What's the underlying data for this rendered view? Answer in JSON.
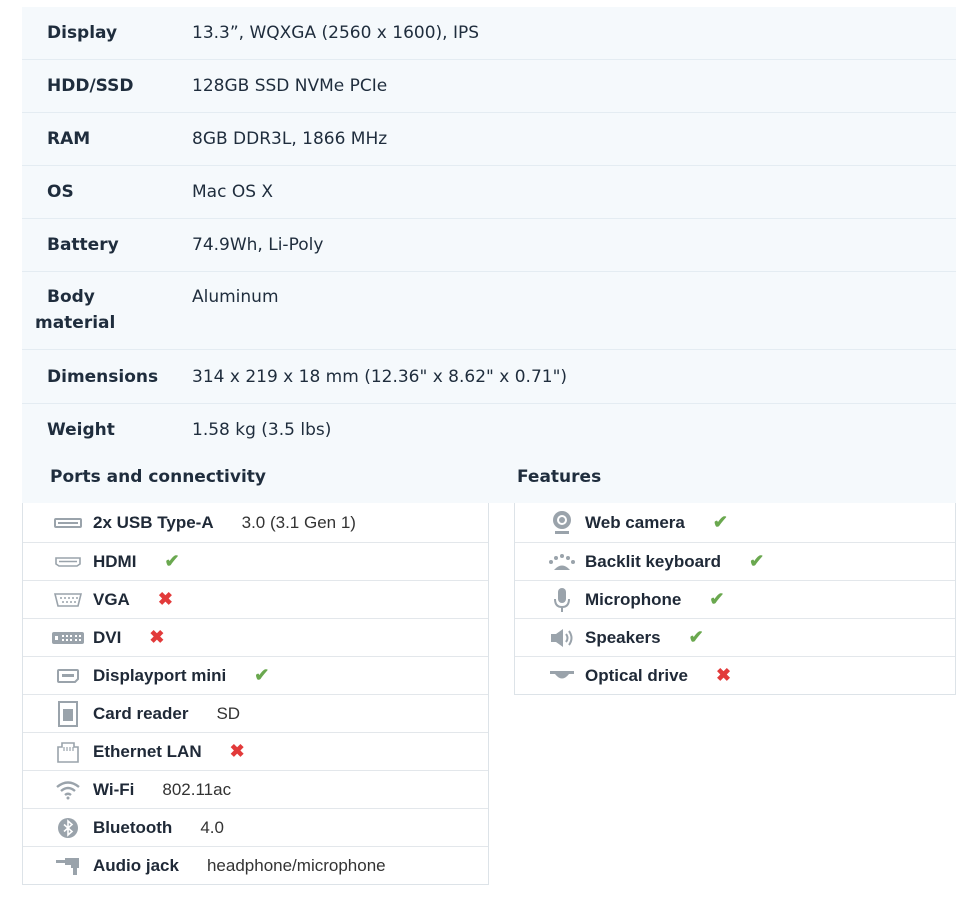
{
  "specs": [
    {
      "label": "Display",
      "value": "13.3”, WQXGA (2560 x 1600), IPS"
    },
    {
      "label": "HDD/SSD",
      "value": "128GB SSD NVMe PCIe"
    },
    {
      "label": "RAM",
      "value": "8GB DDR3L, 1866 MHz"
    },
    {
      "label": "OS",
      "value": "Mac OS X"
    },
    {
      "label": "Battery",
      "value": "74.9Wh, Li-Poly"
    },
    {
      "label_line1": "Body",
      "label_line2": "material",
      "value": "Aluminum"
    },
    {
      "label": "Dimensions",
      "value": "314 x 219 x 18 mm (12.36\" x 8.62\" x 0.71\")"
    },
    {
      "label": "Weight",
      "value": "1.58 kg (3.5 lbs)"
    }
  ],
  "ports": {
    "title": "Ports and connectivity",
    "items": [
      {
        "name": "2x USB Type-A",
        "value": "3.0 (3.1 Gen 1)",
        "icon": "usb-icon"
      },
      {
        "name": "HDMI",
        "status": "yes",
        "mark": "✔",
        "icon": "hdmi-icon"
      },
      {
        "name": "VGA",
        "status": "no",
        "mark": "✖",
        "icon": "vga-icon"
      },
      {
        "name": "DVI",
        "status": "no",
        "mark": "✖",
        "icon": "dvi-icon"
      },
      {
        "name": "Displayport mini",
        "status": "yes",
        "mark": "✔",
        "icon": "displayport-icon"
      },
      {
        "name": "Card reader",
        "value": "SD",
        "icon": "sd-card-icon"
      },
      {
        "name": "Ethernet LAN",
        "status": "no",
        "mark": "✖",
        "icon": "ethernet-icon"
      },
      {
        "name": "Wi-Fi",
        "value": "802.11ac",
        "icon": "wifi-icon"
      },
      {
        "name": "Bluetooth",
        "value": "4.0",
        "icon": "bluetooth-icon"
      },
      {
        "name": "Audio jack",
        "value": "headphone/microphone",
        "icon": "audio-jack-icon"
      }
    ]
  },
  "features": {
    "title": "Features",
    "items": [
      {
        "name": "Web camera",
        "status": "yes",
        "mark": "✔",
        "icon": "webcam-icon"
      },
      {
        "name": "Backlit keyboard",
        "status": "yes",
        "mark": "✔",
        "icon": "backlit-keyboard-icon"
      },
      {
        "name": "Microphone",
        "status": "yes",
        "mark": "✔",
        "icon": "microphone-icon"
      },
      {
        "name": "Speakers",
        "status": "yes",
        "mark": "✔",
        "icon": "speaker-icon"
      },
      {
        "name": "Optical drive",
        "status": "no",
        "mark": "✖",
        "icon": "optical-drive-icon"
      }
    ]
  },
  "colors": {
    "yes": "#6aa84f",
    "no": "#e23a3a",
    "icon": "#9aa3ab"
  }
}
